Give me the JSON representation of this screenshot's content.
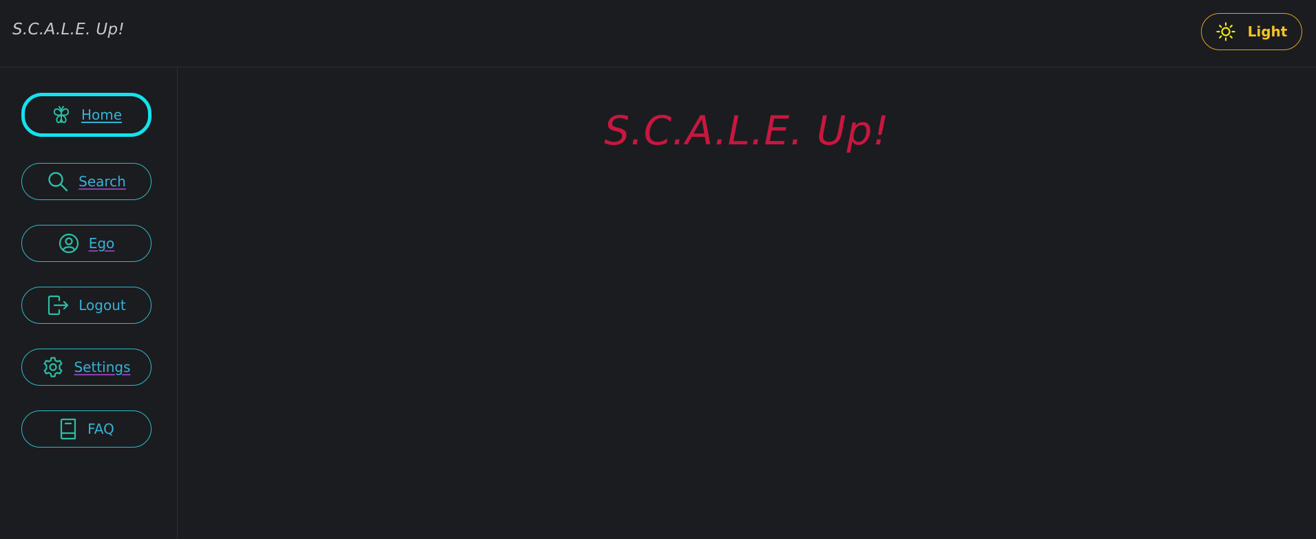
{
  "header": {
    "brand": "S.C.A.L.E. Up!",
    "theme_toggle": {
      "label": "Light",
      "icon": "sun-icon",
      "color": "#f4c325"
    }
  },
  "sidebar": {
    "items": [
      {
        "label": "Home",
        "icon": "butterfly-icon",
        "active": true
      },
      {
        "label": "Search",
        "icon": "search-icon",
        "active": false
      },
      {
        "label": "Ego",
        "icon": "user-circle-icon",
        "active": false
      },
      {
        "label": "Logout",
        "icon": "logout-icon",
        "active": false
      },
      {
        "label": "Settings",
        "icon": "gear-icon",
        "active": false
      },
      {
        "label": "FAQ",
        "icon": "book-icon",
        "active": false
      }
    ],
    "accent": "#2bbec9",
    "active_border": "#12e3ee"
  },
  "main": {
    "title": "S.C.A.L.E. Up!",
    "title_color": "#c8173f"
  }
}
